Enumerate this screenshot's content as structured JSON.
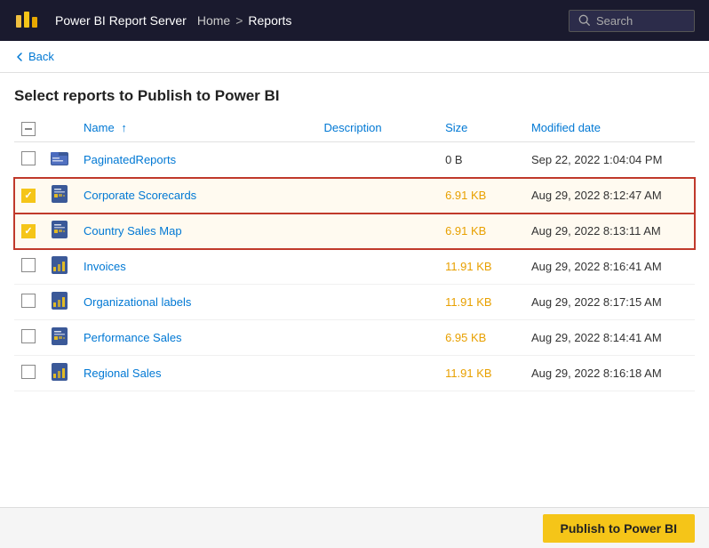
{
  "header": {
    "logo_alt": "Power BI logo",
    "app_title": "Power BI Report Server",
    "breadcrumb_home": "Home",
    "breadcrumb_sep": ">",
    "breadcrumb_current": "Reports",
    "search_placeholder": "Search"
  },
  "back": {
    "label": "Back"
  },
  "page_title": "Select reports to Publish to Power BI",
  "table": {
    "columns": {
      "name": "Name",
      "name_sort": "↑",
      "description": "Description",
      "size": "Size",
      "modified_date": "Modified date"
    },
    "rows": [
      {
        "id": "paginated-reports",
        "checked": false,
        "icon_type": "folder",
        "name": "PaginatedReports",
        "description": "",
        "size": "0 B",
        "size_colored": false,
        "modified": "Sep 22, 2022 1:04:04 PM",
        "selected": false
      },
      {
        "id": "corporate-scorecards",
        "checked": true,
        "icon_type": "report",
        "name": "Corporate Scorecards",
        "description": "",
        "size": "6.91 KB",
        "size_colored": true,
        "modified": "Aug 29, 2022 8:12:47 AM",
        "selected": true
      },
      {
        "id": "country-sales-map",
        "checked": true,
        "icon_type": "report",
        "name": "Country Sales Map",
        "description": "",
        "size": "6.91 KB",
        "size_colored": true,
        "modified": "Aug 29, 2022 8:13:11 AM",
        "selected": true
      },
      {
        "id": "invoices",
        "checked": false,
        "icon_type": "bar",
        "name": "Invoices",
        "description": "",
        "size": "11.91 KB",
        "size_colored": true,
        "modified": "Aug 29, 2022 8:16:41 AM",
        "selected": false
      },
      {
        "id": "organizational-labels",
        "checked": false,
        "icon_type": "bar",
        "name": "Organizational labels",
        "description": "",
        "size": "11.91 KB",
        "size_colored": true,
        "modified": "Aug 29, 2022 8:17:15 AM",
        "selected": false
      },
      {
        "id": "performance-sales",
        "checked": false,
        "icon_type": "report",
        "name": "Performance Sales",
        "description": "",
        "size": "6.95 KB",
        "size_colored": true,
        "modified": "Aug 29, 2022 8:14:41 AM",
        "selected": false
      },
      {
        "id": "regional-sales",
        "checked": false,
        "icon_type": "bar",
        "name": "Regional Sales",
        "description": "",
        "size": "11.91 KB",
        "size_colored": true,
        "modified": "Aug 29, 2022 8:16:18 AM",
        "selected": false
      }
    ]
  },
  "publish_button": "Publish to Power BI"
}
